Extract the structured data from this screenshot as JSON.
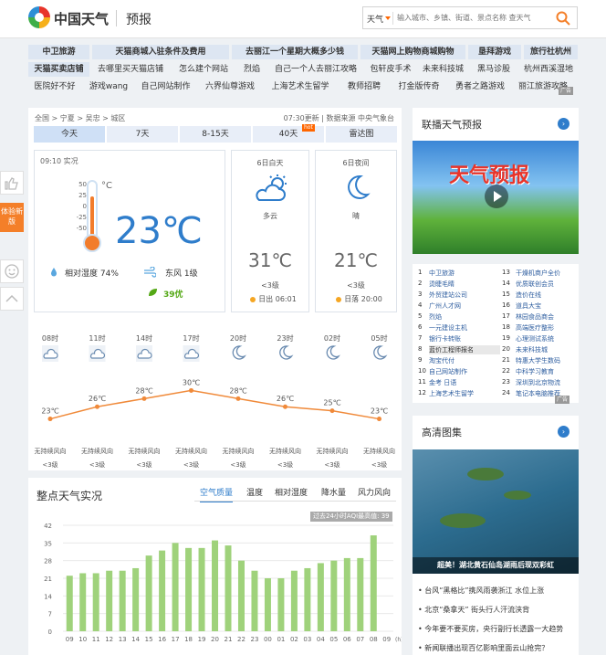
{
  "header": {
    "logo_text": "中国天气",
    "sub": "预报",
    "search_cat": "天气",
    "search_placeholder": "输入城市、乡镇、街道、景点名称 查天气"
  },
  "ads": {
    "row1": [
      "中卫旅游",
      "天猫商城入驻条件及费用",
      "去丽江一个星期大概多少钱",
      "天猫网上购物商城购物",
      "垦拜游戏",
      "旅行社杭州"
    ],
    "row2": [
      "天猫买卖店铺",
      "去哪里买天猫店铺",
      "怎么建个网站",
      "烈焰",
      "自己一个人去丽江攻略",
      "包轩皮手术",
      "未来科技城",
      "黑马诊股",
      "杭州西溪湿地"
    ],
    "row3": [
      "医院好不好",
      "游戏wang",
      "自己网站制作",
      "六界仙尊游戏",
      "上海艺术生留学",
      "教师招聘",
      "打金版传奇",
      "勇者之路游戏",
      "丽江旅游攻略"
    ],
    "badge": "广告"
  },
  "sidebar": {
    "new_label": "体验新版"
  },
  "main": {
    "crumb": "全国 > 宁夏 > 吴忠 > 城区",
    "source": "07:30更新 | 数据来源 中央气象台",
    "tabs": [
      "今天",
      "7天",
      "8-15天",
      "40天",
      "雷达图"
    ],
    "hot": "hot",
    "live": {
      "time": "09:10 实况",
      "scale": [
        "50",
        "25",
        "0",
        "-25",
        "-50"
      ],
      "unit": "°C",
      "temp": "23℃",
      "humidity": "相对湿度 74%",
      "wind": "东风 1级",
      "aqi": "39优",
      "thermo_level": 0.73
    },
    "day": {
      "title": "6日白天",
      "cond": "多云",
      "temp": "31℃",
      "wind": "<3级",
      "sun": "日出 06:01"
    },
    "night": {
      "title": "6日夜间",
      "cond": "晴",
      "temp": "21℃",
      "wind": "<3级",
      "sun": "日落 20:00"
    },
    "hourly": {
      "hours": [
        "08时",
        "11时",
        "14时",
        "17时",
        "20时",
        "23时",
        "02时",
        "05时"
      ],
      "icons": [
        "cloud-icon",
        "cloud-icon",
        "cloud-icon",
        "cloud-icon",
        "moon-icon",
        "moon-icon",
        "moon-icon",
        "moon-icon"
      ],
      "temps": [
        23,
        26,
        28,
        30,
        28,
        26,
        25,
        23
      ],
      "temp_labels": [
        "23℃",
        "26℃",
        "28℃",
        "30℃",
        "28℃",
        "26℃",
        "25℃",
        "23℃"
      ],
      "wind_dir": [
        "无持续风向",
        "无持续风向",
        "无持续风向",
        "无持续风向",
        "无持续风向",
        "无持续风向",
        "无持续风向",
        "无持续风向"
      ],
      "wind_lvl": [
        "<3级",
        "<3级",
        "<3级",
        "<3级",
        "<3级",
        "<3级",
        "<3级",
        "<3级"
      ]
    }
  },
  "obs": {
    "title": "整点天气实况",
    "tabs": [
      "空气质量",
      "温度",
      "相对湿度",
      "降水量",
      "风力风向"
    ],
    "note": "过去24小时AQI最高值: 39",
    "chart_data": {
      "type": "bar",
      "categories": [
        "09",
        "10",
        "11",
        "12",
        "13",
        "14",
        "15",
        "16",
        "17",
        "18",
        "19",
        "20",
        "21",
        "22",
        "23",
        "00",
        "01",
        "02",
        "03",
        "04",
        "05",
        "06",
        "07",
        "08",
        "09"
      ],
      "values": [
        22,
        23,
        23,
        24,
        24,
        25,
        30,
        32,
        35,
        33,
        33,
        36,
        34,
        28,
        24,
        21,
        21,
        24,
        25,
        27,
        28,
        29,
        29,
        38,
        null
      ],
      "ylim": [
        0,
        42
      ],
      "yticks": [
        0,
        7,
        14,
        21,
        28,
        35,
        42
      ],
      "color": "#9fd27b",
      "xunit": "(h)"
    }
  },
  "right": {
    "forecast_title": "联播天气预报",
    "video_title": "天气预报",
    "rank": [
      [
        "1",
        "中卫旅游",
        "13",
        "干燥机商户全价"
      ],
      [
        "2",
        "烫睫毛睛",
        "14",
        "优质联创会员"
      ],
      [
        "3",
        "外贸建站公司",
        "15",
        "造价在线"
      ],
      [
        "4",
        "广州人才网",
        "16",
        "道具大宝"
      ],
      [
        "5",
        "烈焰",
        "17",
        "林园食品商会"
      ],
      [
        "6",
        "一元建设主机",
        "18",
        "高端医疗整形"
      ],
      [
        "7",
        "银行卡转账",
        "19",
        "心理测试系统"
      ],
      [
        "8",
        "蓝价工程师报名",
        "20",
        "未来科技城"
      ],
      [
        "9",
        "淘宝代付",
        "21",
        "特惠大学生数码"
      ],
      [
        "10",
        "自己网站制作",
        "22",
        "中科学习教育"
      ],
      [
        "11",
        "金考 日语",
        "23",
        "深圳到北京物流"
      ],
      [
        "12",
        "上海艺术生留学",
        "24",
        "笔记本电脑推荐"
      ]
    ],
    "rank_badge": "广告",
    "gallery_title": "高清图集",
    "photo_caption": "超美！湖北黄石仙岛湖雨后现双彩虹",
    "news": [
      "台风“黑格比”携风雨袭浙江 水位上涨",
      "北京“桑拿天” 街头行人汗流浃背",
      "今年要不要买房，央行副行长透露一大趋势",
      "新闻联播出现百亿影响里面云山抢完？"
    ]
  }
}
